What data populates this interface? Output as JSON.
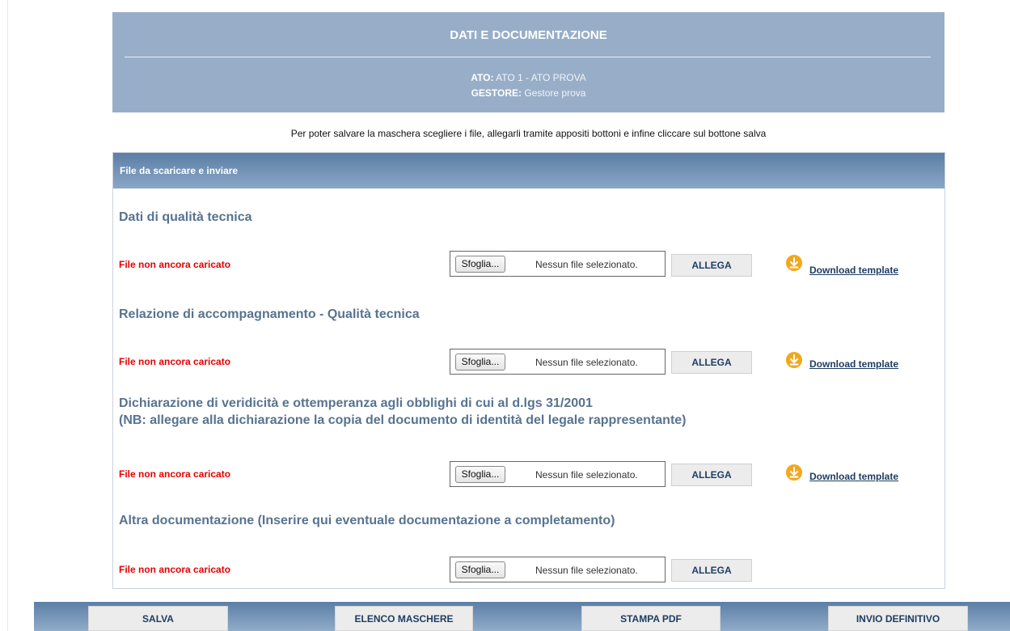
{
  "header": {
    "title": "DATI E DOCUMENTAZIONE",
    "ato_label": "ATO:",
    "ato_value": "ATO 1 - ATO PROVA",
    "gestore_label": "GESTORE:",
    "gestore_value": "Gestore prova"
  },
  "instructions": "Per poter salvare la maschera scegliere i file, allegarli tramite appositi bottoni e infine cliccare sul bottone salva",
  "panel": {
    "title": "File da scaricare e inviare",
    "sections": [
      {
        "title_line1": "Dati di qualità tecnica",
        "title_line2": "",
        "status": "File non ancora caricato",
        "browse_label": "Sfoglia...",
        "no_file": "Nessun file selezionato.",
        "allega_label": "ALLEGA",
        "download_label": "Download template"
      },
      {
        "title_line1": "Relazione di accompagnamento - Qualità tecnica",
        "title_line2": "",
        "status": "File non ancora caricato",
        "browse_label": "Sfoglia...",
        "no_file": "Nessun file selezionato.",
        "allega_label": "ALLEGA",
        "download_label": "Download template"
      },
      {
        "title_line1": "Dichiarazione di veridicità e ottemperanza agli obblighi di cui al d.lgs 31/2001",
        "title_line2": "(NB: allegare alla dichiarazione la copia del documento di identità del legale rappresentante)",
        "status": "File non ancora caricato",
        "browse_label": "Sfoglia...",
        "no_file": "Nessun file selezionato.",
        "allega_label": "ALLEGA",
        "download_label": "Download template"
      },
      {
        "title_line1": "Altra documentazione (Inserire qui eventuale documentazione a completamento)",
        "title_line2": "",
        "status": "File non ancora caricato",
        "browse_label": "Sfoglia...",
        "no_file": "Nessun file selezionato.",
        "allega_label": "ALLEGA",
        "download_label": ""
      }
    ]
  },
  "toolbar": {
    "save": "SALVA",
    "list": "ELENCO MASCHERE",
    "print": "STAMPA PDF",
    "send": "INVIO DEFINITIVO"
  },
  "colors": {
    "header_bg": "#98aec8",
    "panel_head": "#6f8fb3",
    "section_title": "#587390",
    "status_red": "#e60000",
    "button_text": "#1f3d63",
    "download_icon": "#f2a81d"
  }
}
